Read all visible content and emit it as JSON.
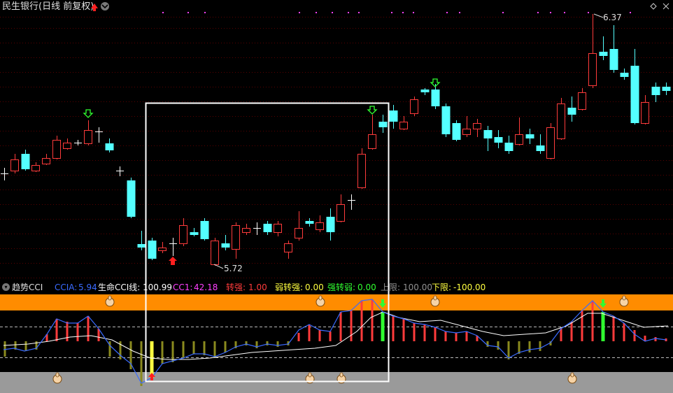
{
  "window": {
    "title": "民生银行(日线 前复权)",
    "controls_glyph": "◇ ✕"
  },
  "price_panel": {
    "high_label": "6.37",
    "low_label": "5.72"
  },
  "indicator": {
    "name": "趋势CCI",
    "ccia_label": "CCIA:",
    "ccia_value": "5.94",
    "life_label": "生命CCI线:",
    "life_value": "100.99",
    "cc1_label": "CC1:",
    "cc1_value": "42.18",
    "zq_label": "转强:",
    "zq_value": "1.00",
    "rzq_label": "弱转强:",
    "rzq_value": "0.00",
    "qzr_label": "强转弱:",
    "qzr_value": "0.00",
    "upper_label": "上限:",
    "upper_value": "100.00",
    "lower_label": "下限:",
    "lower_value": "-100.00"
  },
  "colors": {
    "up": "#ff3b3b",
    "down": "#54ffff",
    "doji": "#ffffff",
    "orange_band": "#ff8c00",
    "gray_band": "#9a9a9a",
    "ccia": "#3a6bff",
    "cc1": "#ff40ff",
    "zq": "#ff3b3b",
    "rzq": "#ffff40",
    "qzr": "#30ff30",
    "upper": "#909090",
    "lower": "#ffff40",
    "white_line": "#ffffff",
    "olive_bar": "#8a8a1e",
    "marker_dot": "#ff40ff"
  },
  "icons": {
    "signal_up": "arrow-up-icon",
    "hand_up": "thumbs-up-icon",
    "hand_point": "hand-point-icon"
  }
}
